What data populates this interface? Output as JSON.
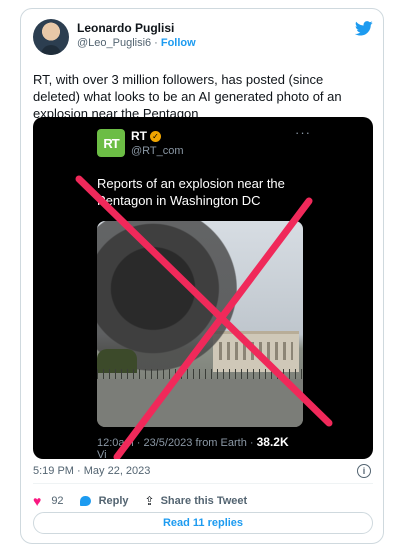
{
  "author": {
    "name": "Leonardo Puglisi",
    "handle": "@Leo_Puglisi6",
    "separator": "·",
    "follow_label": "Follow"
  },
  "tweet": {
    "text": "RT, with over 3 million followers, has posted (since deleted) what looks to be an AI generated photo of an explosion near the Pentagon",
    "timestamp": "5:19 PM · May 22, 2023",
    "likes": "92",
    "reply_label": "Reply",
    "share_label": "Share this Tweet",
    "read_replies_label": "Read 11 replies"
  },
  "embedded": {
    "logo_text": "RT",
    "name": "RT",
    "verified_mark": "✓",
    "handle": "@RT_com",
    "more": "···",
    "headline": "Reports of an explosion near the Pentagon in Washington DC",
    "footer_time": "12:0",
    "footer_rest": "am · 23/5/2023 from Earth · ",
    "footer_views": "38.2K",
    "footer_bottom": "Vi"
  },
  "colors": {
    "accent": "#1d9bf0",
    "cross": "#f0295a",
    "like": "#f91880",
    "rt_green": "#6cbd45"
  },
  "icons": {
    "brand": "twitter-bird-icon",
    "like": "heart-icon",
    "reply": "reply-bubble-icon",
    "share": "share-icon",
    "info": "info-icon"
  }
}
